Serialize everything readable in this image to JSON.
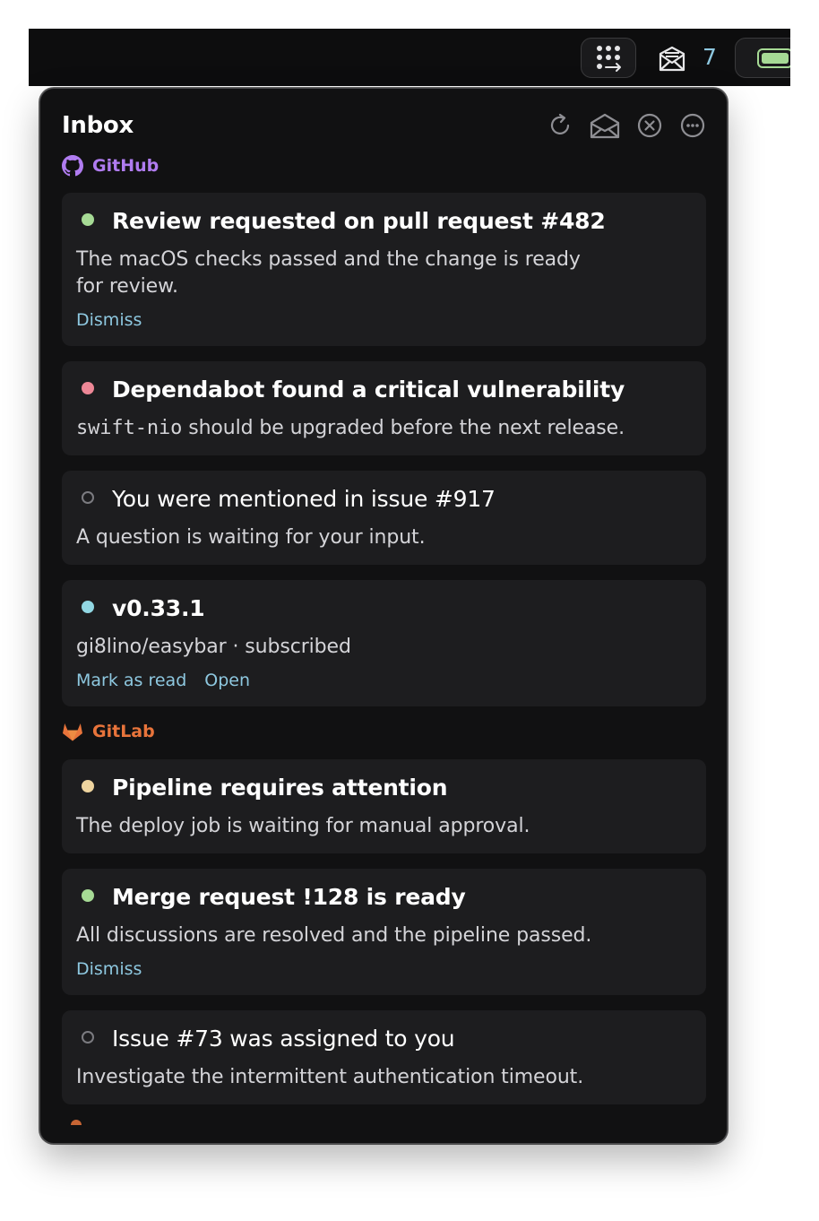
{
  "menubar": {
    "grid_icon": "dots-grid-arrow-icon",
    "mail_icon": "envelope-icon",
    "unread_count": "7",
    "battery_icon": "battery-icon",
    "colors": {
      "count": "#8ec8e0",
      "battery": "#a6da95"
    }
  },
  "panel": {
    "title": "Inbox",
    "header_icons": [
      "refresh-icon",
      "mark-all-read-icon",
      "close-icon",
      "more-icon"
    ]
  },
  "sections": [
    {
      "name": "GitHub",
      "icon": "github-icon",
      "color": "#b07cf0",
      "items": [
        {
          "status_color": "#a6da95",
          "unread": true,
          "title": "Review requested on pull request #482",
          "body_line1": "The macOS checks passed and the change is ready",
          "body_line2": "for review.",
          "actions": [
            "Dismiss"
          ]
        },
        {
          "status_color": "#ed8796",
          "unread": true,
          "title": "Dependabot found a critical vulnerability",
          "body_code": "swift-nio",
          "body_rest": " should be upgraded before the next release.",
          "actions": []
        },
        {
          "status_color": "#7b7b80",
          "unread": false,
          "title": "You were mentioned in issue #917",
          "body": "A question is waiting for your input.",
          "actions": []
        },
        {
          "status_color": "#91d7e3",
          "unread": true,
          "title": "v0.33.1",
          "body": "gi8lino/easybar · subscribed",
          "actions": [
            "Mark as read",
            "Open"
          ]
        }
      ]
    },
    {
      "name": "GitLab",
      "icon": "gitlab-icon",
      "color": "#e8743b",
      "items": [
        {
          "status_color": "#eed49f",
          "unread": true,
          "title": "Pipeline requires attention",
          "body": "The deploy job is waiting for manual approval.",
          "actions": []
        },
        {
          "status_color": "#a6da95",
          "unread": true,
          "title": "Merge request !128 is ready",
          "body": "All discussions are resolved and the pipeline passed.",
          "actions": [
            "Dismiss"
          ]
        },
        {
          "status_color": "#7b7b80",
          "unread": false,
          "title": "Issue #73 was assigned to you",
          "body": "Investigate the intermittent authentication timeout.",
          "actions": []
        }
      ]
    }
  ]
}
